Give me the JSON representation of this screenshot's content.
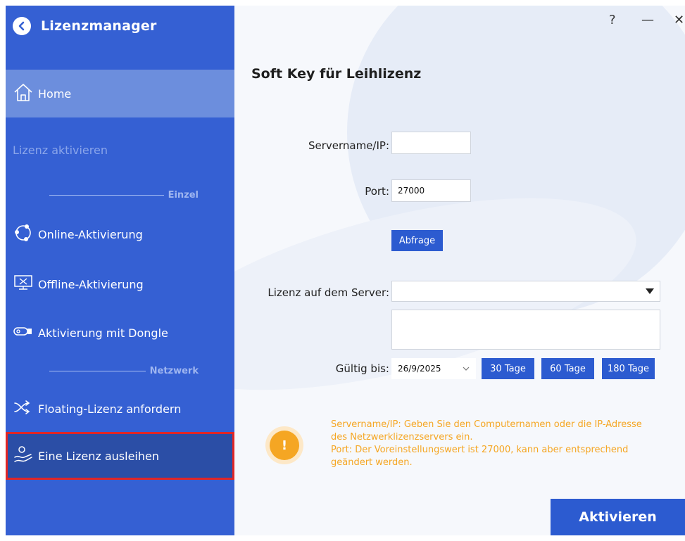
{
  "app": {
    "title": "Lizenzmanager"
  },
  "window_controls": {
    "help": "?",
    "minimize": "—",
    "close": "✕"
  },
  "sidebar": {
    "home": "Home",
    "section_label": "Lizenz aktivieren",
    "group_single": "Einzel",
    "group_network": "Netzwerk",
    "items": [
      {
        "label": "Online-Aktivierung",
        "icon": "online-activation-icon"
      },
      {
        "label": "Offline-Aktivierung",
        "icon": "monitor-icon"
      },
      {
        "label": "Aktivierung mit Dongle",
        "icon": "dongle-icon"
      },
      {
        "label": "Floating-Lizenz anfordern",
        "icon": "shuffle-icon"
      },
      {
        "label": "Eine Lizenz ausleihen",
        "icon": "borrow-license-icon",
        "selected": true
      }
    ]
  },
  "main": {
    "title": "Soft Key für Leihlizenz",
    "form": {
      "server_label": "Servername/IP:",
      "server_value": "",
      "port_label": "Port:",
      "port_value": "27000",
      "query_button": "Abfrage",
      "license_label": "Lizenz auf dem Server:",
      "license_value": "",
      "valid_label": "Gültig bis:",
      "valid_date": "26/9/2025",
      "quick_buttons": [
        "30 Tage",
        "60 Tage",
        "180 Tage"
      ]
    },
    "info_icon": "!",
    "info_lines": [
      "Servername/IP: Geben Sie den Computernamen oder die IP-Adresse",
      "des Netzwerklizenzservers ein.",
      "Port: Der Voreinstellungswert ist 27000, kann aber entsprechend",
      "geändert werden."
    ],
    "activate_button": "Aktivieren"
  },
  "colors": {
    "sidebar": "#3560d3",
    "accent": "#2c5bd0",
    "warning": "#f5a623",
    "highlight_border": "#e02626"
  }
}
